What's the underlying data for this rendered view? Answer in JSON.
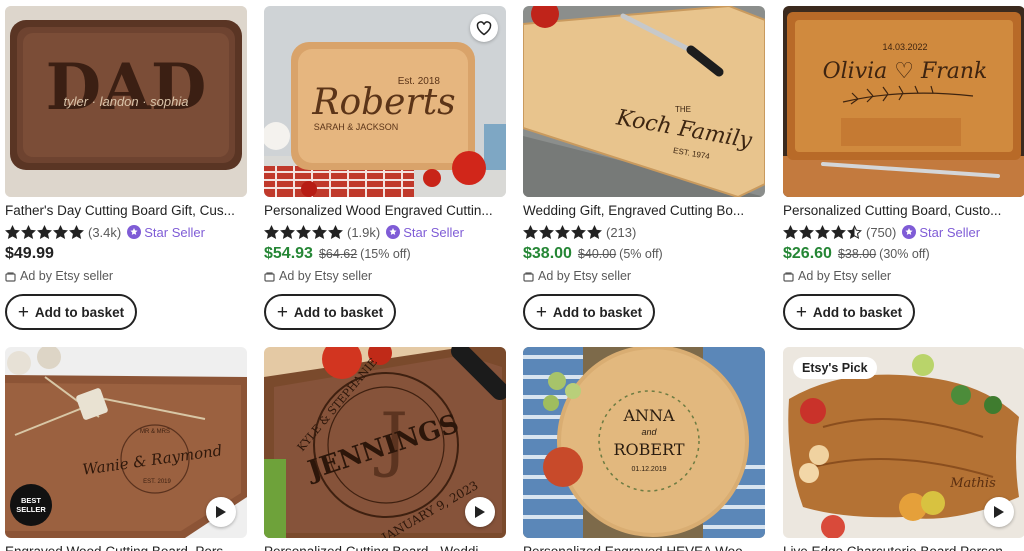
{
  "colors": {
    "sale_price": "#258635",
    "star_seller": "#7f5cd6",
    "star": "#222222"
  },
  "labels": {
    "add_to_basket": "Add to basket",
    "ad": "Ad by Etsy seller",
    "star_seller": "Star Seller"
  },
  "products": [
    {
      "title": "Father's Day Cutting Board Gift, Cus...",
      "rating": 5,
      "reviews": "(3.4k)",
      "star_seller": true,
      "price": "$49.99",
      "engraving": {
        "main": "DAD",
        "sub": "tyler · landon · sophia"
      }
    },
    {
      "title": "Personalized Wood Engraved Cuttin...",
      "rating": 5,
      "reviews": "(1.9k)",
      "star_seller": true,
      "price": "$54.93",
      "original_price": "$64.62",
      "discount": "(15% off)",
      "engraving": {
        "top": "Est. 2018",
        "main": "Roberts",
        "sub": "SARAH & JACKSON"
      }
    },
    {
      "title": "Wedding Gift, Engraved Cutting Bo...",
      "rating": 5,
      "reviews": "(213)",
      "star_seller": false,
      "price": "$38.00",
      "original_price": "$40.00",
      "discount": "(5% off)",
      "engraving": {
        "top": "THE",
        "main": "Koch Family",
        "sub": "EST. 1974"
      }
    },
    {
      "title": "Personalized Cutting Board, Custo...",
      "rating": 4.5,
      "reviews": "(750)",
      "star_seller": true,
      "price": "$26.60",
      "original_price": "$38.00",
      "discount": "(30% off)",
      "engraving": {
        "top": "14.03.2022",
        "main": "Olivia ♡ Frank"
      }
    },
    {
      "title": "Engraved Wood Cutting Board, Pers...",
      "badge": "BEST SELLER",
      "engraving": {
        "top": "MR & MRS",
        "main": "Wanie & Raymond",
        "sub": "EST. 2019"
      }
    },
    {
      "title": "Personalized Cutting Board - Weddi...",
      "engraving": {
        "top": "KYLE & STEPHANIE",
        "main": "JENNINGS",
        "letter": "J",
        "sub": "JANUARY 9, 2023"
      }
    },
    {
      "title": "Personalized Engraved HEVEA Woo...",
      "engraving": {
        "top": "ANNA",
        "mid": "and",
        "main": "ROBERT",
        "sub": "01.12.2019"
      }
    },
    {
      "title": "Live Edge Charcuterie Board Person...",
      "pick": "Etsy's Pick",
      "engraving": {
        "main": "Mathis"
      }
    }
  ]
}
